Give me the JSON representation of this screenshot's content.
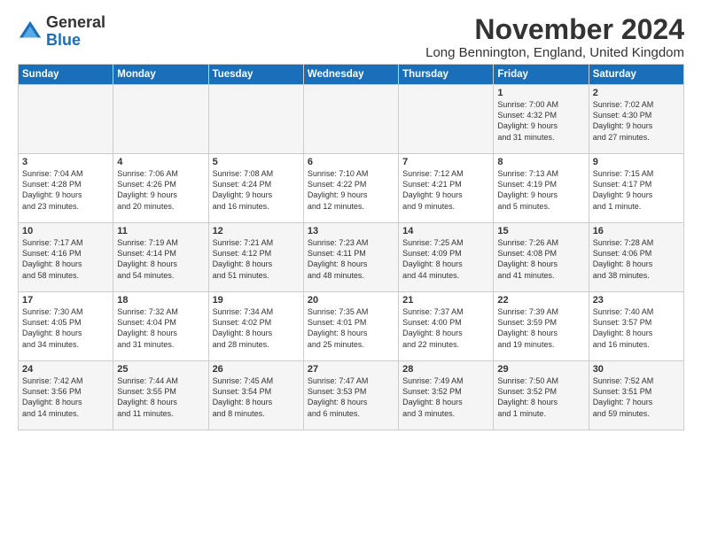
{
  "logo": {
    "general": "General",
    "blue": "Blue"
  },
  "title": "November 2024",
  "location": "Long Bennington, England, United Kingdom",
  "days_of_week": [
    "Sunday",
    "Monday",
    "Tuesday",
    "Wednesday",
    "Thursday",
    "Friday",
    "Saturday"
  ],
  "weeks": [
    [
      {
        "day": "",
        "info": ""
      },
      {
        "day": "",
        "info": ""
      },
      {
        "day": "",
        "info": ""
      },
      {
        "day": "",
        "info": ""
      },
      {
        "day": "",
        "info": ""
      },
      {
        "day": "1",
        "info": "Sunrise: 7:00 AM\nSunset: 4:32 PM\nDaylight: 9 hours\nand 31 minutes."
      },
      {
        "day": "2",
        "info": "Sunrise: 7:02 AM\nSunset: 4:30 PM\nDaylight: 9 hours\nand 27 minutes."
      }
    ],
    [
      {
        "day": "3",
        "info": "Sunrise: 7:04 AM\nSunset: 4:28 PM\nDaylight: 9 hours\nand 23 minutes."
      },
      {
        "day": "4",
        "info": "Sunrise: 7:06 AM\nSunset: 4:26 PM\nDaylight: 9 hours\nand 20 minutes."
      },
      {
        "day": "5",
        "info": "Sunrise: 7:08 AM\nSunset: 4:24 PM\nDaylight: 9 hours\nand 16 minutes."
      },
      {
        "day": "6",
        "info": "Sunrise: 7:10 AM\nSunset: 4:22 PM\nDaylight: 9 hours\nand 12 minutes."
      },
      {
        "day": "7",
        "info": "Sunrise: 7:12 AM\nSunset: 4:21 PM\nDaylight: 9 hours\nand 9 minutes."
      },
      {
        "day": "8",
        "info": "Sunrise: 7:13 AM\nSunset: 4:19 PM\nDaylight: 9 hours\nand 5 minutes."
      },
      {
        "day": "9",
        "info": "Sunrise: 7:15 AM\nSunset: 4:17 PM\nDaylight: 9 hours\nand 1 minute."
      }
    ],
    [
      {
        "day": "10",
        "info": "Sunrise: 7:17 AM\nSunset: 4:16 PM\nDaylight: 8 hours\nand 58 minutes."
      },
      {
        "day": "11",
        "info": "Sunrise: 7:19 AM\nSunset: 4:14 PM\nDaylight: 8 hours\nand 54 minutes."
      },
      {
        "day": "12",
        "info": "Sunrise: 7:21 AM\nSunset: 4:12 PM\nDaylight: 8 hours\nand 51 minutes."
      },
      {
        "day": "13",
        "info": "Sunrise: 7:23 AM\nSunset: 4:11 PM\nDaylight: 8 hours\nand 48 minutes."
      },
      {
        "day": "14",
        "info": "Sunrise: 7:25 AM\nSunset: 4:09 PM\nDaylight: 8 hours\nand 44 minutes."
      },
      {
        "day": "15",
        "info": "Sunrise: 7:26 AM\nSunset: 4:08 PM\nDaylight: 8 hours\nand 41 minutes."
      },
      {
        "day": "16",
        "info": "Sunrise: 7:28 AM\nSunset: 4:06 PM\nDaylight: 8 hours\nand 38 minutes."
      }
    ],
    [
      {
        "day": "17",
        "info": "Sunrise: 7:30 AM\nSunset: 4:05 PM\nDaylight: 8 hours\nand 34 minutes."
      },
      {
        "day": "18",
        "info": "Sunrise: 7:32 AM\nSunset: 4:04 PM\nDaylight: 8 hours\nand 31 minutes."
      },
      {
        "day": "19",
        "info": "Sunrise: 7:34 AM\nSunset: 4:02 PM\nDaylight: 8 hours\nand 28 minutes."
      },
      {
        "day": "20",
        "info": "Sunrise: 7:35 AM\nSunset: 4:01 PM\nDaylight: 8 hours\nand 25 minutes."
      },
      {
        "day": "21",
        "info": "Sunrise: 7:37 AM\nSunset: 4:00 PM\nDaylight: 8 hours\nand 22 minutes."
      },
      {
        "day": "22",
        "info": "Sunrise: 7:39 AM\nSunset: 3:59 PM\nDaylight: 8 hours\nand 19 minutes."
      },
      {
        "day": "23",
        "info": "Sunrise: 7:40 AM\nSunset: 3:57 PM\nDaylight: 8 hours\nand 16 minutes."
      }
    ],
    [
      {
        "day": "24",
        "info": "Sunrise: 7:42 AM\nSunset: 3:56 PM\nDaylight: 8 hours\nand 14 minutes."
      },
      {
        "day": "25",
        "info": "Sunrise: 7:44 AM\nSunset: 3:55 PM\nDaylight: 8 hours\nand 11 minutes."
      },
      {
        "day": "26",
        "info": "Sunrise: 7:45 AM\nSunset: 3:54 PM\nDaylight: 8 hours\nand 8 minutes."
      },
      {
        "day": "27",
        "info": "Sunrise: 7:47 AM\nSunset: 3:53 PM\nDaylight: 8 hours\nand 6 minutes."
      },
      {
        "day": "28",
        "info": "Sunrise: 7:49 AM\nSunset: 3:52 PM\nDaylight: 8 hours\nand 3 minutes."
      },
      {
        "day": "29",
        "info": "Sunrise: 7:50 AM\nSunset: 3:52 PM\nDaylight: 8 hours\nand 1 minute."
      },
      {
        "day": "30",
        "info": "Sunrise: 7:52 AM\nSunset: 3:51 PM\nDaylight: 7 hours\nand 59 minutes."
      }
    ]
  ]
}
